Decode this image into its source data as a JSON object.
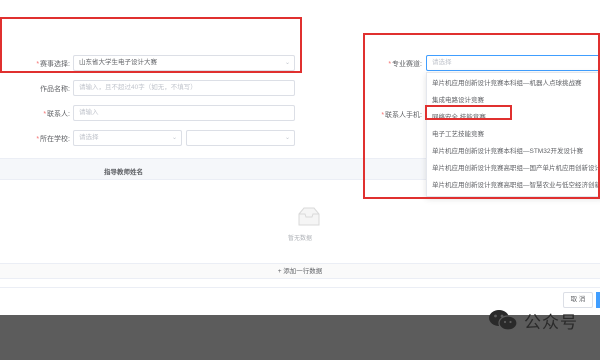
{
  "form": {
    "competition": {
      "label": "赛事选择:",
      "value": "山东省大学生电子设计大赛"
    },
    "work_name": {
      "label": "作品名称:",
      "placeholder": "请输入，且不超过40字（如无，不填写）"
    },
    "contact": {
      "label": "联系人:",
      "placeholder": "请输入"
    },
    "school": {
      "label": "所在学校:",
      "placeholder": "请选择"
    },
    "track": {
      "label": "专业赛道:",
      "placeholder": "请选择"
    },
    "phone": {
      "label": "联系人手机:"
    }
  },
  "dropdown": {
    "options": [
      "单片机应用创新设计竞赛本科组—机器人点球挑战赛",
      "集成电路设计竞赛",
      "网络安全 技能竞赛",
      "电子工艺技能竞赛",
      "单片机应用创新设计竞赛本科组—STM32开发设计赛",
      "单片机应用创新设计竞赛高职组—国产单片机应用创新设计赛",
      "单片机应用创新设计竞赛高职组—智慧农业与低空经济创新"
    ]
  },
  "table": {
    "header": "指导教师姓名",
    "empty_text": "暂无数据"
  },
  "add_row_label": "+ 添加一行数据",
  "footer": {
    "cancel_label": "取 消"
  },
  "watermark": {
    "text": "公众号"
  },
  "colors": {
    "highlight": "#e0302f",
    "primary": "#409eff"
  }
}
